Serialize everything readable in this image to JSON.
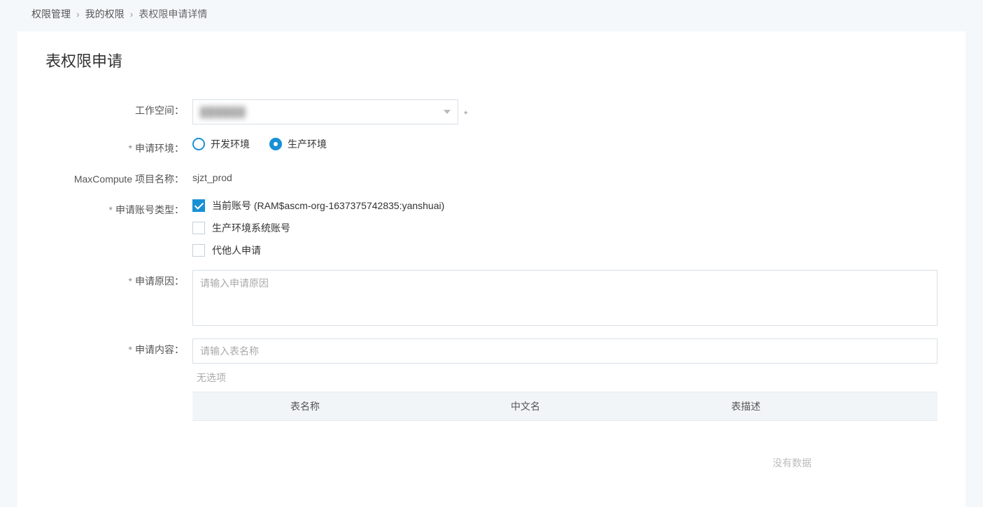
{
  "breadcrumb": {
    "root": "权限管理",
    "mine": "我的权限",
    "current": "表权限申请详情"
  },
  "page_title": "表权限申请",
  "form": {
    "workspace": {
      "label": "工作空间：",
      "value": ""
    },
    "env": {
      "label": "申请环境：",
      "options": {
        "dev": "开发环境",
        "prod": "生产环境"
      },
      "selected": "prod"
    },
    "project": {
      "label": "MaxCompute 项目名称：",
      "value": "sjzt_prod"
    },
    "account_type": {
      "label": "申请账号类型：",
      "options": {
        "current": "当前账号 (RAM$ascm-org-1637375742835:yanshuai)",
        "prod_sys": "生产环境系统账号",
        "proxy": "代他人申请"
      },
      "checked": {
        "current": true,
        "prod_sys": false,
        "proxy": false
      }
    },
    "reason": {
      "label": "申请原因：",
      "placeholder": "请输入申请原因"
    },
    "content": {
      "label": "申请内容：",
      "search_placeholder": "请输入表名称",
      "no_option": "无选项",
      "columns": {
        "name": "表名称",
        "cn": "中文名",
        "desc": "表描述"
      },
      "empty": "没有数据"
    },
    "required_mark": "*"
  }
}
